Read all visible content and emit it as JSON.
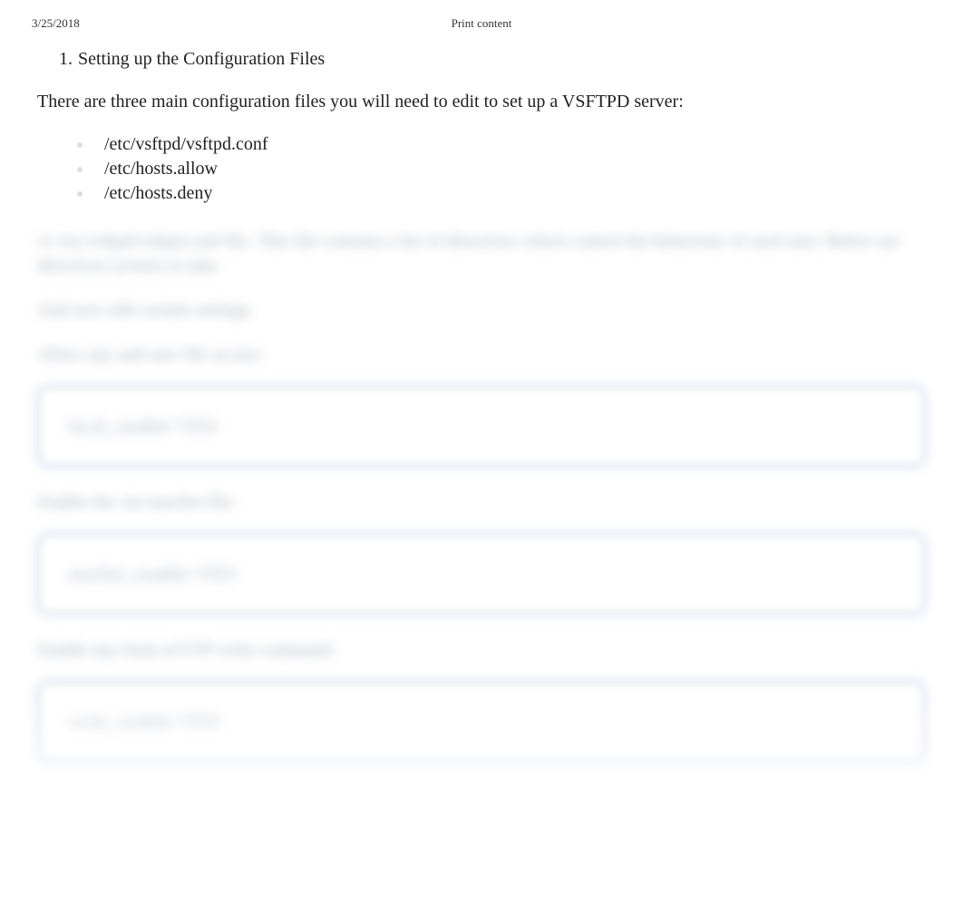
{
  "header": {
    "date": "3/25/2018",
    "title": "Print content"
  },
  "section": {
    "number": "1.",
    "heading": "Setting up the Configuration Files"
  },
  "intro": "There are three main configuration files you will need to edit to set up a VSFTPD server:",
  "files": [
    "/etc/vsftpd/vsftpd.conf",
    "/etc/hosts.allow",
    "/etc/hosts.deny"
  ],
  "blurred": {
    "p1": "vi /etc/vsftpd/vsftpd.conf file. This file contains a list of directives which control the behaviour of each user. Below are directives actions to take.",
    "p2": "And now edit certain settings.",
    "p3": "Allow any and user file access:",
    "code1": "local_enable=YES",
    "p4": "Enable the /etc/userlist file:",
    "code2": "userlist_enable=YES",
    "p5": "Enable any form of FTP write command:",
    "code3": "write_enable=YES"
  }
}
